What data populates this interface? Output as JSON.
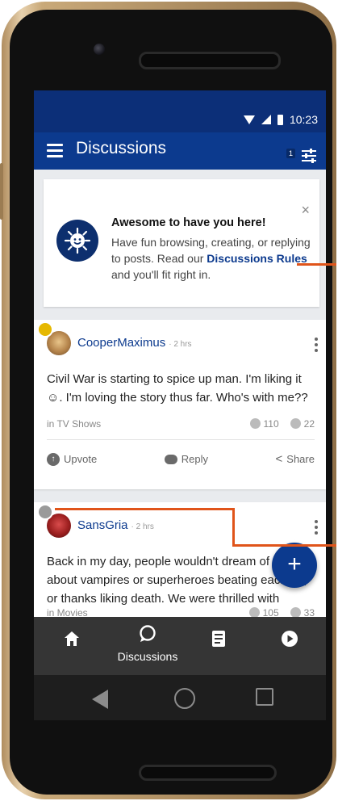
{
  "status_bar": {
    "time": "10:23"
  },
  "app_bar": {
    "title": "Discussions",
    "filter_count": "1"
  },
  "welcome": {
    "title": "Awesome to have you here!",
    "text_before": "Have fun browsing, creating, or replying to posts. Read our ",
    "link": "Discussions Rules",
    "text_after": " and you'll fit right in.",
    "close": "×"
  },
  "posts": [
    {
      "username": "CooperMaximus",
      "time": "· 2 hrs",
      "body": "Civil War is starting to spice up man. I'm liking it ☺. I'm loving the story thus far. Who's with me??",
      "category": "in TV Shows",
      "upvotes": "110",
      "replies": "22",
      "badge_color": "#e6b800"
    },
    {
      "username": "SansGria",
      "time": "· 2 hrs",
      "body": "Back in my day, people wouldn't dream of rea about vampires or superheroes beating each up, or thanks liking death. We were thrilled with",
      "category": "in Movies",
      "upvotes": "105",
      "replies": "33",
      "badge_color": "#9a9a9a"
    }
  ],
  "actions": {
    "upvote": "Upvote",
    "reply": "Reply",
    "share": "Share"
  },
  "fab": {
    "label": "+"
  },
  "bottom_nav": {
    "discussions": "Discussions"
  },
  "colors": {
    "primary": "#0c3a8e",
    "status": "#0c2f78",
    "annotation": "#e0541a"
  }
}
